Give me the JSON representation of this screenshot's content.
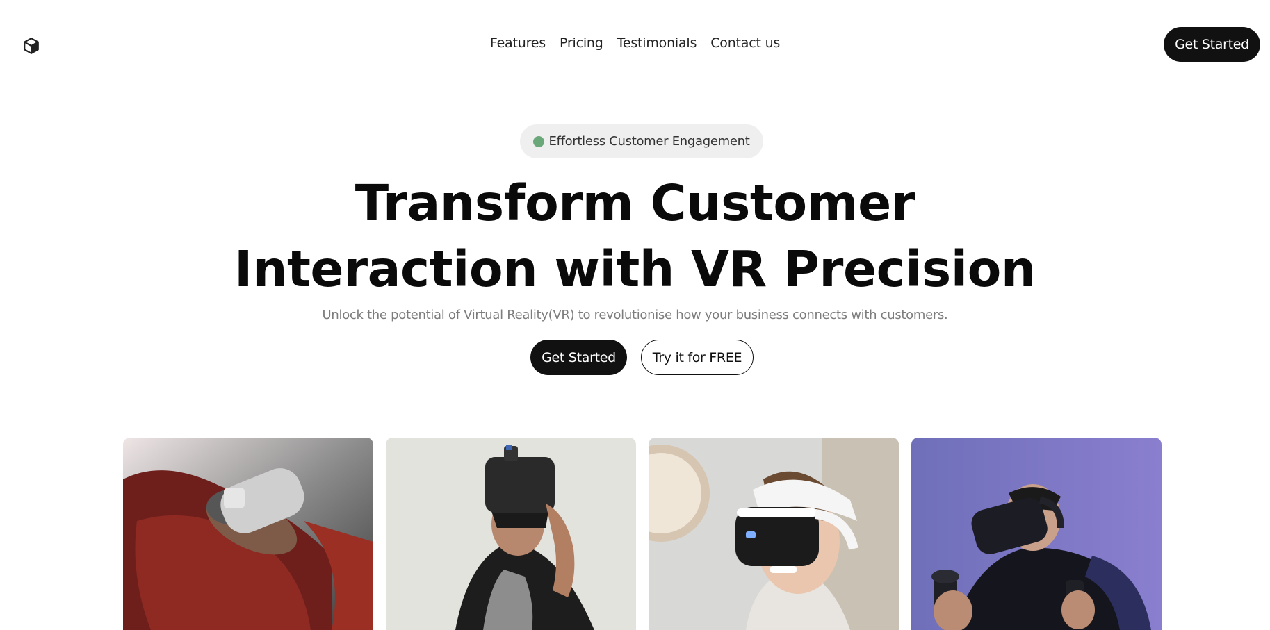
{
  "nav": {
    "links": [
      "Features",
      "Pricing",
      "Testimonials",
      "Contact us"
    ],
    "cta_label": "Get Started"
  },
  "hero": {
    "badge": "Effortless Customer Engagement",
    "title_line1": "Transform Customer",
    "title_line2": "Interaction with VR Precision",
    "subtitle": "Unlock the potential of Virtual Reality(VR) to revolutionise how your business connects with customers.",
    "primary_label": "Get Started",
    "secondary_label": "Try it for FREE"
  },
  "colors": {
    "text": "#111111",
    "muted": "#7c7c7c",
    "badge_bg": "#efefef",
    "badge_dot": "#6aa87a",
    "button_dark": "#111111"
  },
  "gallery": [
    {
      "name": "vr-photo-reclining"
    },
    {
      "name": "vr-photo-headset-lift"
    },
    {
      "name": "vr-photo-white-headset"
    },
    {
      "name": "vr-photo-controllers"
    }
  ]
}
